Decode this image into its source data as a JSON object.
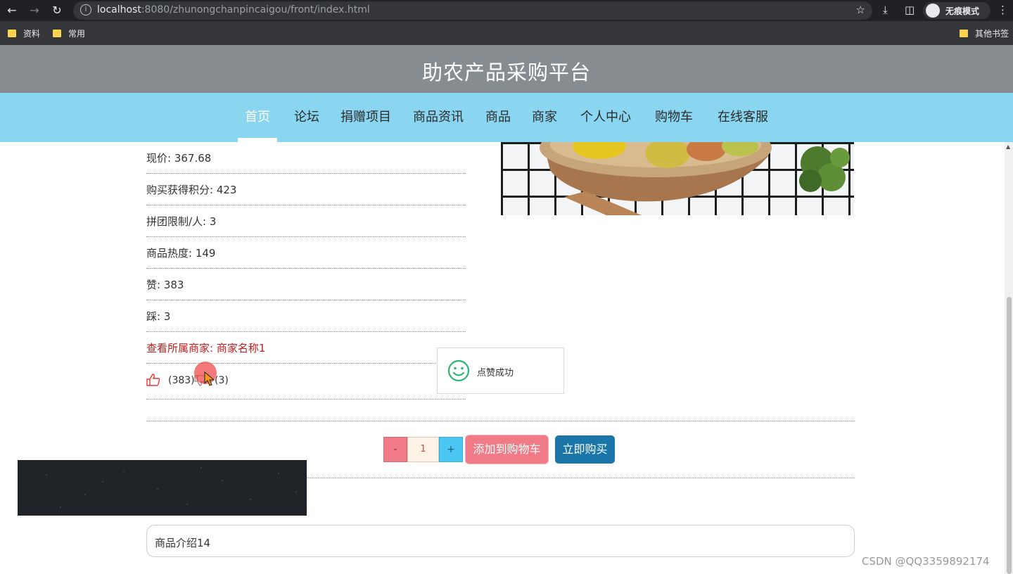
{
  "browser": {
    "url_host": "localhost",
    "url_rest": ":8080/zhunongchanpincaigou/front/index.html",
    "incognito_label": "无痕模式",
    "bookmarks": [
      "资料",
      "常用"
    ],
    "other_bookmarks": "其他书签"
  },
  "site": {
    "title": "助农产品采购平台",
    "nav": [
      "首页",
      "论坛",
      "捐赠项目",
      "商品资讯",
      "商品",
      "商家",
      "个人中心",
      "购物车",
      "在线客服"
    ],
    "active_nav": "首页"
  },
  "product": {
    "details": [
      "现价: 367.68",
      "购买获得积分: 423",
      "拼团限制/人: 3",
      "商品热度: 149",
      "赞: 383",
      "踩: 3"
    ],
    "merchant_link": "查看所属商家: 商家名称1",
    "likes": "(383)",
    "dislikes": "(3)",
    "quantity": "1",
    "description": "商品介绍14"
  },
  "actions": {
    "minus": "-",
    "plus": "+",
    "add_to_cart": "添加到购物车",
    "buy_now": "立即购买"
  },
  "toast": {
    "message": "点赞成功"
  },
  "watermark": "CSDN @QQ3359892174",
  "colors": {
    "header_bg": "#878c91",
    "nav_bg": "#8ad5f0",
    "merchant_link": "#c41d1d",
    "cart_button": "#f07b87",
    "buy_button": "#1a76a9",
    "toast_icon": "#2bb673"
  }
}
